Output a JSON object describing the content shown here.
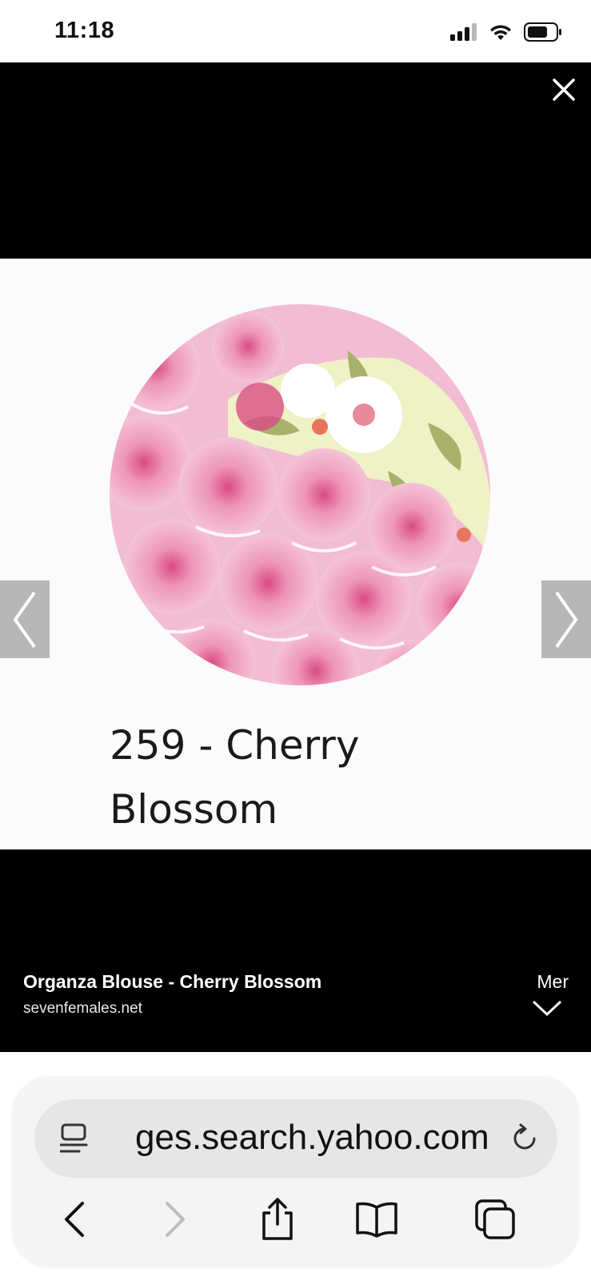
{
  "status": {
    "time": "11:18"
  },
  "image": {
    "caption": "259 - Cherry Blossom"
  },
  "result": {
    "title": "Organza Blouse - Cherry Blossom",
    "source": "sevenfemales.net",
    "more_label": "Mer"
  },
  "browser": {
    "url": "ges.search.yahoo.com"
  },
  "colors": {
    "viewer_bg": "#000000",
    "fabric_pink": "#f2bcd3",
    "fabric_accent": "#dd5b8e",
    "leaf_green": "#a9b06a"
  }
}
